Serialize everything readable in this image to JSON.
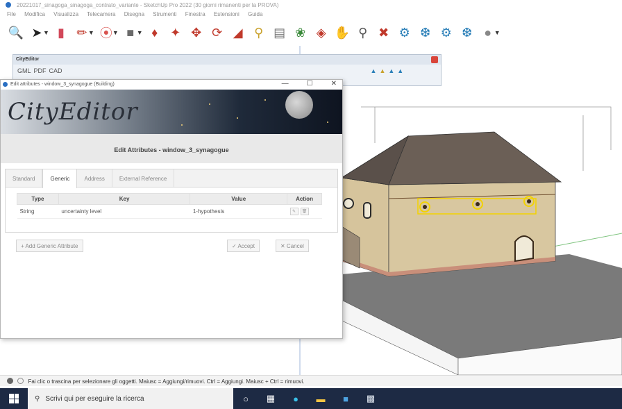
{
  "window": {
    "title": "20221017_sinagoga_sinagoga_contrato_variante - SketchUp Pro 2022 (30 giorni rimanenti per la PROVA)",
    "menus": [
      "File",
      "Modifica",
      "Visualizza",
      "Telecamera",
      "Disegna",
      "Strumenti",
      "Finestra",
      "Estensioni",
      "Guida"
    ]
  },
  "toolbar": {
    "icons": [
      "search-icon",
      "select-arrow-icon",
      "eraser-icon",
      "pencil-line-icon",
      "arc-icon",
      "rectangle-icon",
      "push-pull-icon",
      "paint-bucket-icon",
      "move-icon",
      "rotate-icon",
      "scale-icon",
      "tape-measure-icon",
      "text-icon",
      "paint-icon",
      "orbit-icon",
      "pan-icon",
      "zoom-icon",
      "zoom-extents-icon",
      "warehouse-icon",
      "extensions-icon",
      "ruby-icon",
      "section-icon",
      "geo-icon"
    ]
  },
  "cityeditor_toolbar": {
    "title": "CityEditor",
    "items": [
      "GML",
      "PDF",
      "CAD"
    ]
  },
  "dialog": {
    "title": "Edit attributes - window_3_synagogue (Building)",
    "logo": "CityEditor",
    "heading": "Edit Attributes - window_3_synagogue",
    "tabs": [
      "Standard",
      "Generic",
      "Address",
      "External Reference"
    ],
    "active_tab": "Generic",
    "table": {
      "headers": [
        "Type",
        "Key",
        "Value",
        "Action"
      ],
      "rows": [
        {
          "type": "String",
          "key": "uncertainty level",
          "value": "1-hypothesis"
        }
      ]
    },
    "add_button": "+ Add Generic Attribute",
    "accept_button": "✓ Accept",
    "cancel_button": "✕ Cancel"
  },
  "statusbar": {
    "hint": "Fai clic o trascina per selezionare gli oggetti. Maiusc = Aggiungi/rimuovi. Ctrl = Aggiungi. Maiusc + Ctrl = rimuovi."
  },
  "taskbar": {
    "search_placeholder": "Scrivi qui per eseguire la ricerca"
  }
}
